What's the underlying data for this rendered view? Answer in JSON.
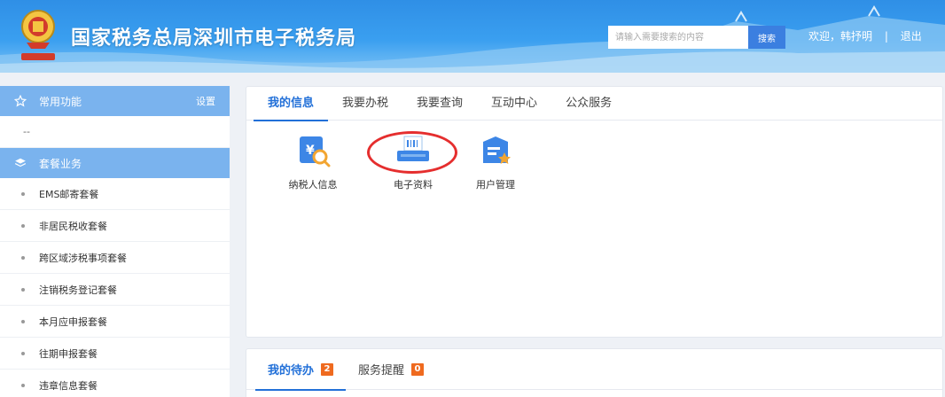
{
  "header": {
    "title": "国家税务总局深圳市电子税务局",
    "search_placeholder": "请输入需要搜索的内容",
    "search_button": "搜索",
    "welcome": "欢迎，韩抒明",
    "separator": "|",
    "logout": "退出",
    "colors": {
      "bar": "#3a9ff0",
      "search_button": "#3b7fe0"
    }
  },
  "sidebar": {
    "favorites_title": "常用功能",
    "settings": "设置",
    "favorites_empty": "--",
    "package_title": "套餐业务",
    "package_items": [
      "EMS邮寄套餐",
      "非居民税收套餐",
      "跨区域涉税事项套餐",
      "注销税务登记套餐",
      "本月应申报套餐",
      "往期申报套餐",
      "违章信息套餐"
    ],
    "icons": [
      "star-icon",
      "layers-icon"
    ]
  },
  "main": {
    "tabs": [
      "我的信息",
      "我要办税",
      "我要查询",
      "互动中心",
      "公众服务"
    ],
    "active_tab": 0,
    "apps": [
      {
        "label": "纳税人信息",
        "icon": "taxpayer-info-icon"
      },
      {
        "label": "电子资料",
        "icon": "electronic-document-icon"
      },
      {
        "label": "用户管理",
        "icon": "user-management-icon"
      }
    ],
    "highlight_color": "#e52e2e"
  },
  "todo": {
    "tabs": [
      {
        "label": "我的待办",
        "count": "2"
      },
      {
        "label": "服务提醒",
        "count": "0"
      }
    ],
    "badge_color": "#ef6a1f"
  }
}
